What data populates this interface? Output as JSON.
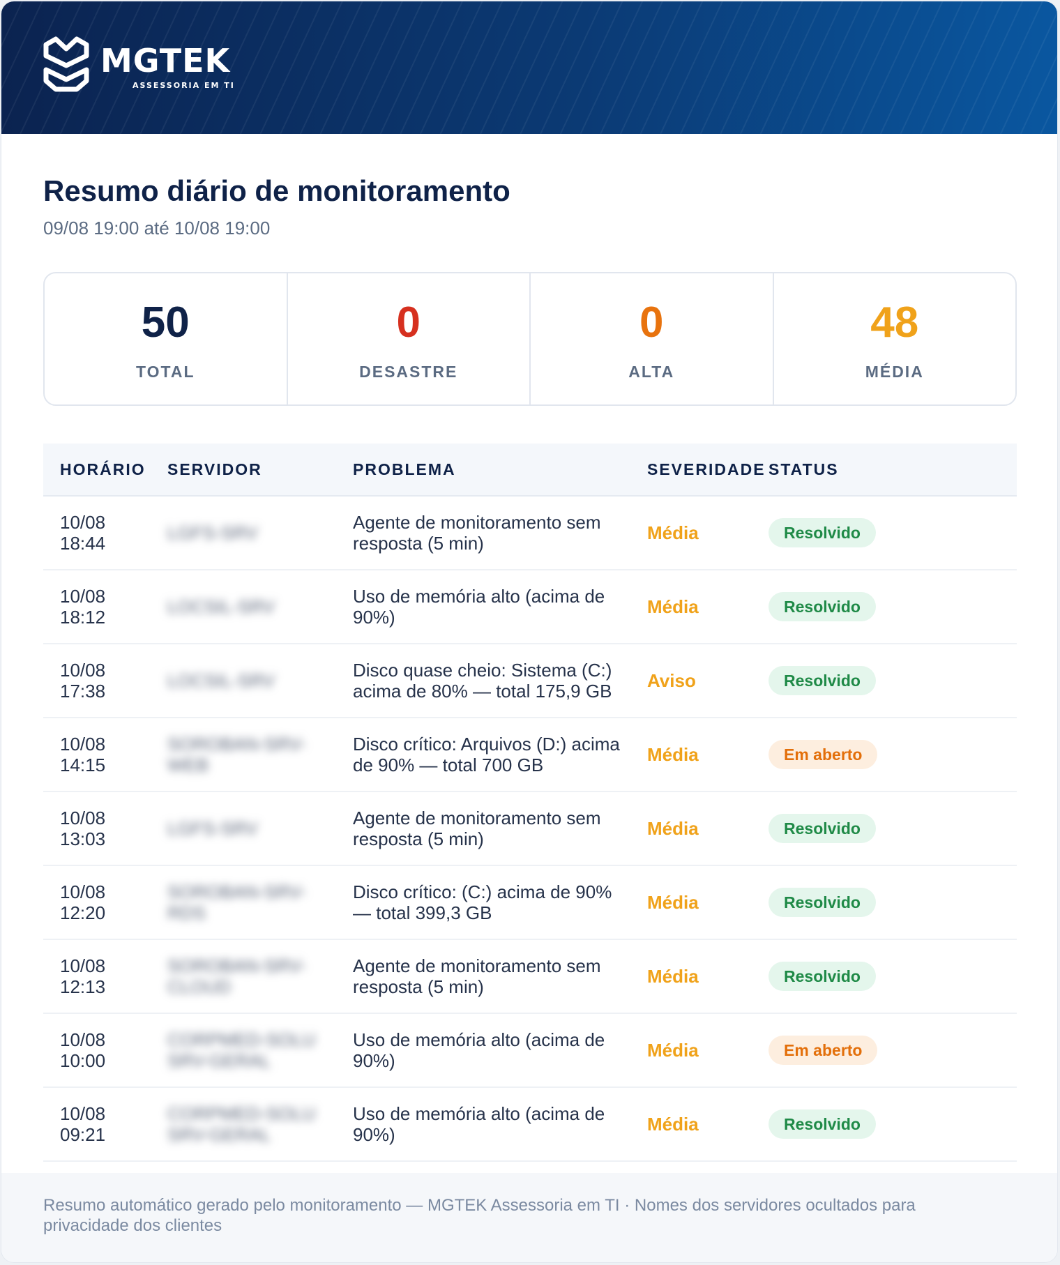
{
  "brand": {
    "name": "MGTEK",
    "tagline": "ASSESSORIA EM TI",
    "logo_icon": "mgtek-logo-icon"
  },
  "report": {
    "title": "Resumo diário de monitoramento",
    "period": "09/08 19:00 até 10/08 19:00"
  },
  "stats": [
    {
      "value": "50",
      "label": "TOTAL",
      "color": "#0f2248"
    },
    {
      "value": "0",
      "label": "DESASTRE",
      "color": "#d6301f"
    },
    {
      "value": "0",
      "label": "ALTA",
      "color": "#e8730e"
    },
    {
      "value": "48",
      "label": "MÉDIA",
      "color": "#f0a21a"
    }
  ],
  "table": {
    "columns": [
      "HORÁRIO",
      "SERVIDOR",
      "PROBLEMA",
      "SEVERIDADE",
      "STATUS"
    ],
    "rows": [
      {
        "date": "10/08",
        "time": "18:44",
        "server": [
          "LGFS-SRV"
        ],
        "problem": "Agente de monitoramento sem resposta (5 min)",
        "severity": "Média",
        "status": "Resolvido"
      },
      {
        "date": "10/08",
        "time": "18:12",
        "server": [
          "LOCSIL-SRV"
        ],
        "problem": "Uso de memória alto (acima de 90%)",
        "severity": "Média",
        "status": "Resolvido"
      },
      {
        "date": "10/08",
        "time": "17:38",
        "server": [
          "LOCSIL-SRV"
        ],
        "problem": "Disco quase cheio: Sistema (C:) acima de 80% — total 175,9 GB",
        "severity": "Aviso",
        "status": "Resolvido"
      },
      {
        "date": "10/08",
        "time": "14:15",
        "server": [
          "SOROBAN-SRV-",
          "WEB"
        ],
        "problem": "Disco crítico: Arquivos (D:) acima de 90% — total 700 GB",
        "severity": "Média",
        "status": "Em aberto"
      },
      {
        "date": "10/08",
        "time": "13:03",
        "server": [
          "LGFS-SRV"
        ],
        "problem": "Agente de monitoramento sem resposta (5 min)",
        "severity": "Média",
        "status": "Resolvido"
      },
      {
        "date": "10/08",
        "time": "12:20",
        "server": [
          "SOROBAN-SRV-RDS"
        ],
        "problem": "Disco crítico: (C:) acima de 90% — total 399,3 GB",
        "severity": "Média",
        "status": "Resolvido"
      },
      {
        "date": "10/08",
        "time": "12:13",
        "server": [
          "SOROBAN-SRV-",
          "CLOUD"
        ],
        "problem": "Agente de monitoramento sem resposta (5 min)",
        "severity": "Média",
        "status": "Resolvido"
      },
      {
        "date": "10/08",
        "time": "10:00",
        "server": [
          "CORPMED-SOLU",
          "SRV-GERAL"
        ],
        "problem": "Uso de memória alto (acima de 90%)",
        "severity": "Média",
        "status": "Em aberto"
      },
      {
        "date": "10/08",
        "time": "09:21",
        "server": [
          "CORPMED-SOLU",
          "SRV-GERAL"
        ],
        "problem": "Uso de memória alto (acima de 90%)",
        "severity": "Média",
        "status": "Resolvido"
      }
    ]
  },
  "colors": {
    "severity": "#f0a21a",
    "resolved_bg": "#e4f6ec",
    "resolved_text": "#1f8a47",
    "open_bg": "#fdeedf",
    "open_text": "#e36f0a"
  },
  "footer": {
    "text": "Resumo automático gerado pelo monitoramento — MGTEK Assessoria em TI · Nomes dos servidores ocultados para privacidade dos clientes"
  }
}
